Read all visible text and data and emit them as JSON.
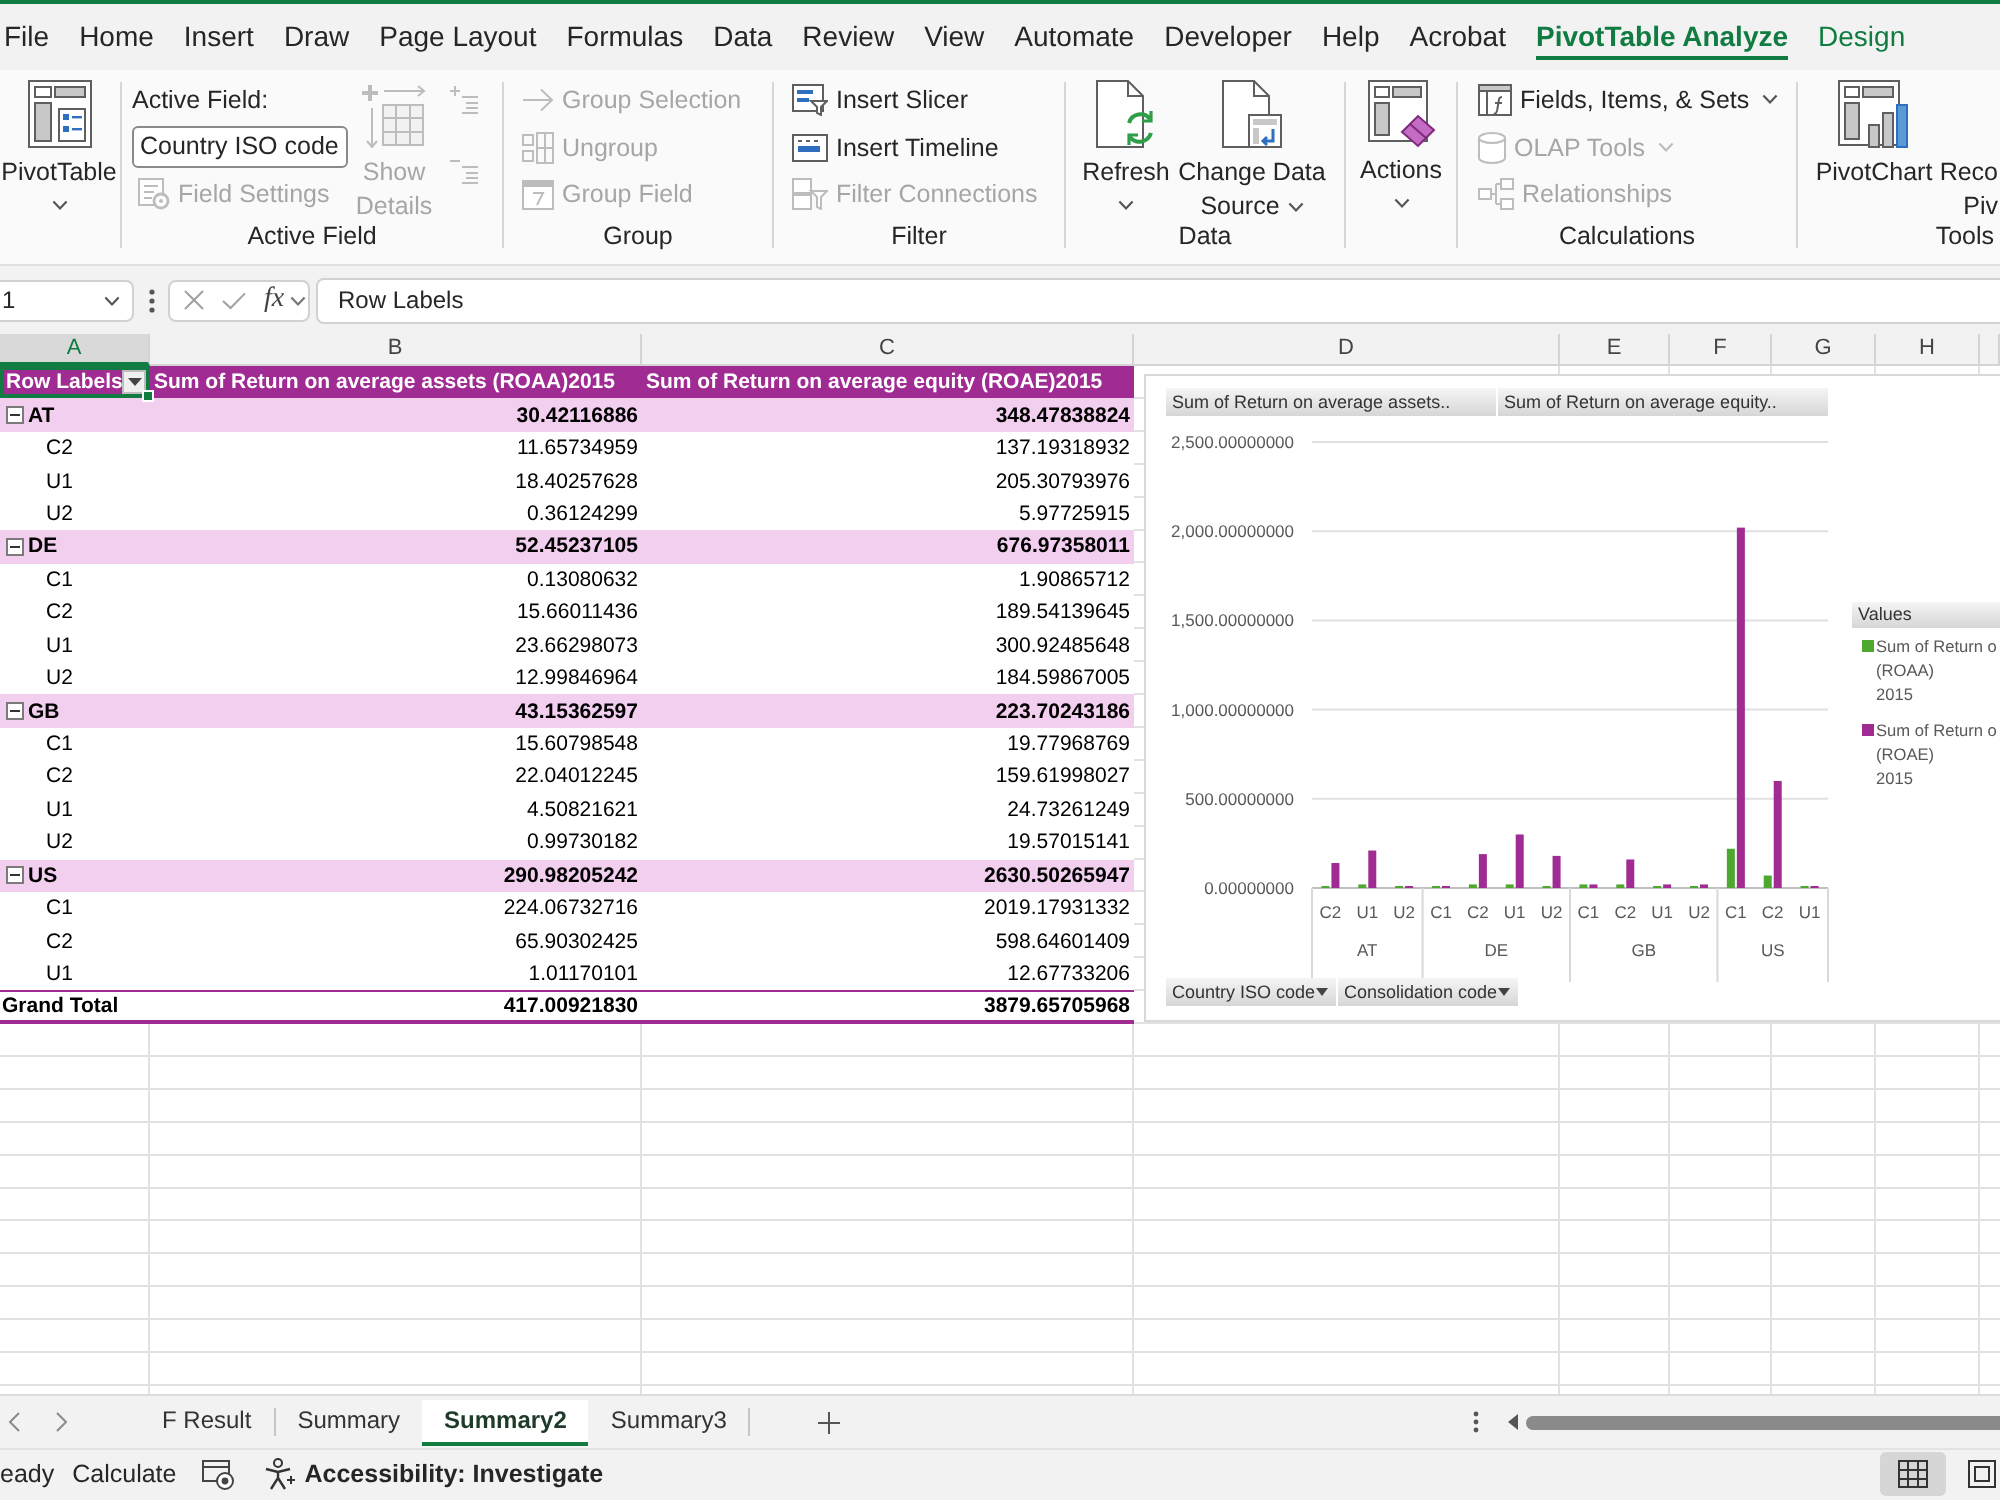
{
  "menu_tabs": [
    {
      "label": "File",
      "selected": false,
      "contextual": false
    },
    {
      "label": "Home",
      "selected": false,
      "contextual": false
    },
    {
      "label": "Insert",
      "selected": false,
      "contextual": false
    },
    {
      "label": "Draw",
      "selected": false,
      "contextual": false
    },
    {
      "label": "Page Layout",
      "selected": false,
      "contextual": false
    },
    {
      "label": "Formulas",
      "selected": false,
      "contextual": false
    },
    {
      "label": "Data",
      "selected": false,
      "contextual": false
    },
    {
      "label": "Review",
      "selected": false,
      "contextual": false
    },
    {
      "label": "View",
      "selected": false,
      "contextual": false
    },
    {
      "label": "Automate",
      "selected": false,
      "contextual": false
    },
    {
      "label": "Developer",
      "selected": false,
      "contextual": false
    },
    {
      "label": "Help",
      "selected": false,
      "contextual": false
    },
    {
      "label": "Acrobat",
      "selected": false,
      "contextual": false
    },
    {
      "label": "PivotTable Analyze",
      "selected": true,
      "contextual": true
    },
    {
      "label": "Design",
      "selected": false,
      "contextual": true
    }
  ],
  "ribbon": [
    {
      "kind": "pivottable",
      "button": {
        "label": "PivotTable",
        "dropdown": true
      }
    },
    {
      "kind": "active_field",
      "title": "Active Field",
      "caption": "Active Field:",
      "field": {
        "value": "Country ISO code"
      },
      "field_settings": {
        "label": "Field Settings",
        "disabled": true
      },
      "show_details": {
        "label": "Show Details",
        "disabled": true
      },
      "expand_field": {
        "disabled": true
      },
      "collapse_field": {
        "disabled": true
      }
    },
    {
      "kind": "group",
      "title": "Group",
      "items": [
        {
          "label": "Group Selection",
          "disabled": true,
          "dropdown": false
        },
        {
          "label": "Ungroup",
          "disabled": true,
          "dropdown": false
        },
        {
          "label": "Group Field",
          "disabled": true,
          "dropdown": false
        }
      ]
    },
    {
      "kind": "filter",
      "title": "Filter",
      "items": [
        {
          "label": "Insert Slicer",
          "disabled": false,
          "dropdown": false
        },
        {
          "label": "Insert Timeline",
          "disabled": false,
          "dropdown": false
        },
        {
          "label": "Filter Connections",
          "disabled": true,
          "dropdown": false
        }
      ]
    },
    {
      "kind": "data",
      "title": "Data",
      "buttons": [
        {
          "label": "Refresh",
          "dropdown": true
        },
        {
          "label": "Change Data Source",
          "dropdown": true
        }
      ]
    },
    {
      "kind": "actions",
      "button": {
        "label": "Actions",
        "dropdown": true
      }
    },
    {
      "kind": "calculations",
      "title": "Calculations",
      "items": [
        {
          "label": "Fields, Items, & Sets",
          "disabled": false,
          "dropdown": true
        },
        {
          "label": "OLAP Tools",
          "disabled": true,
          "dropdown": true
        },
        {
          "label": "Relationships",
          "disabled": true,
          "dropdown": false
        }
      ]
    },
    {
      "kind": "tools",
      "title": "Tools",
      "buttons": [
        {
          "label": "PivotChart"
        },
        {
          "label": "Reco\nPiv"
        }
      ]
    }
  ],
  "formula_bar": {
    "name_box": "1",
    "function_button": "fx",
    "formula": "Row Labels"
  },
  "column_headers": [
    {
      "label": "A",
      "selected": true
    },
    {
      "label": "B",
      "selected": false
    },
    {
      "label": "C",
      "selected": false
    },
    {
      "label": "D",
      "selected": false
    },
    {
      "label": "E",
      "selected": false
    },
    {
      "label": "F",
      "selected": false
    },
    {
      "label": "G",
      "selected": false
    },
    {
      "label": "H",
      "selected": false
    }
  ],
  "pivot": {
    "header": {
      "label": "Row Labels",
      "selected": true,
      "columns": [
        "Sum of Return on average assets (ROAA)2015",
        "Sum of Return on average equity (ROAE)2015"
      ]
    },
    "groups": [
      {
        "label": "AT",
        "expanded": true,
        "values": [
          "30.42116886",
          "348.47838824"
        ],
        "children": [
          {
            "label": "C2",
            "values": [
              "11.65734959",
              "137.19318932"
            ]
          },
          {
            "label": "U1",
            "values": [
              "18.40257628",
              "205.30793976"
            ]
          },
          {
            "label": "U2",
            "values": [
              "0.36124299",
              "5.97725915"
            ]
          }
        ]
      },
      {
        "label": "DE",
        "expanded": true,
        "values": [
          "52.45237105",
          "676.97358011"
        ],
        "children": [
          {
            "label": "C1",
            "values": [
              "0.13080632",
              "1.90865712"
            ]
          },
          {
            "label": "C2",
            "values": [
              "15.66011436",
              "189.54139645"
            ]
          },
          {
            "label": "U1",
            "values": [
              "23.66298073",
              "300.92485648"
            ]
          },
          {
            "label": "U2",
            "values": [
              "12.99846964",
              "184.59867005"
            ]
          }
        ]
      },
      {
        "label": "GB",
        "expanded": true,
        "values": [
          "43.15362597",
          "223.70243186"
        ],
        "children": [
          {
            "label": "C1",
            "values": [
              "15.60798548",
              "19.77968769"
            ]
          },
          {
            "label": "C2",
            "values": [
              "22.04012245",
              "159.61998027"
            ]
          },
          {
            "label": "U1",
            "values": [
              "4.50821621",
              "24.73261249"
            ]
          },
          {
            "label": "U2",
            "values": [
              "0.99730182",
              "19.57015141"
            ]
          }
        ]
      },
      {
        "label": "US",
        "expanded": true,
        "values": [
          "290.98205242",
          "2630.50265947"
        ],
        "children": [
          {
            "label": "C1",
            "values": [
              "224.06732716",
              "2019.17931332"
            ]
          },
          {
            "label": "C2",
            "values": [
              "65.90302425",
              "598.64601409"
            ]
          },
          {
            "label": "U1",
            "values": [
              "1.01170101",
              "12.67733206"
            ]
          }
        ]
      }
    ],
    "grand_total": {
      "label": "Grand Total",
      "values": [
        "417.00921830",
        "3879.65705968"
      ]
    }
  },
  "chart": {
    "field_buttons": [
      "Sum of Return on average assets..",
      "Sum of Return on average equity.."
    ],
    "filter_buttons": [
      "Country ISO code",
      "Consolidation code"
    ],
    "legend_title": "Values",
    "chart_data": {
      "type": "bar",
      "categories": [
        "C2",
        "U1",
        "U2",
        "C1",
        "C2",
        "U1",
        "U2",
        "C1",
        "C2",
        "U1",
        "U2",
        "C1",
        "C2",
        "U1"
      ],
      "series": [
        {
          "name": "Sum of Return o\n(ROAA)\n2015",
          "color": "#4ea72e",
          "values": [
            10,
            20,
            0,
            0,
            20,
            20,
            10,
            20,
            20,
            0,
            0,
            220,
            70,
            0
          ]
        },
        {
          "name": "Sum of Return o\n(ROAE)\n2015",
          "color": "#a02b93",
          "values": [
            140,
            210,
            10,
            0,
            190,
            300,
            180,
            20,
            160,
            20,
            20,
            2020,
            600,
            10
          ]
        }
      ],
      "ylim": [
        0,
        2500
      ],
      "yticks": [
        {
          "value": 0,
          "label": "0.00000000"
        },
        {
          "value": 500,
          "label": "500.00000000"
        },
        {
          "value": 1000,
          "label": "1,000.00000000"
        },
        {
          "value": 1500,
          "label": "1,500.00000000"
        },
        {
          "value": 2000,
          "label": "2,000.00000000"
        },
        {
          "value": 2500,
          "label": "2,500.00000000"
        }
      ],
      "grid": true,
      "annotations": [
        "AT",
        "DE",
        "GB",
        "US"
      ]
    }
  },
  "sheet_tabs": [
    {
      "label": "F Result",
      "selected": false
    },
    {
      "label": "Summary",
      "selected": false
    },
    {
      "label": "Summary2",
      "selected": true
    },
    {
      "label": "Summary3",
      "selected": false
    }
  ],
  "status_bar": {
    "texts": [
      "eady",
      "Calculate"
    ],
    "accessibility": "Accessibility: Investigate",
    "views": [
      {
        "selected": true
      },
      {
        "selected": false
      }
    ]
  }
}
